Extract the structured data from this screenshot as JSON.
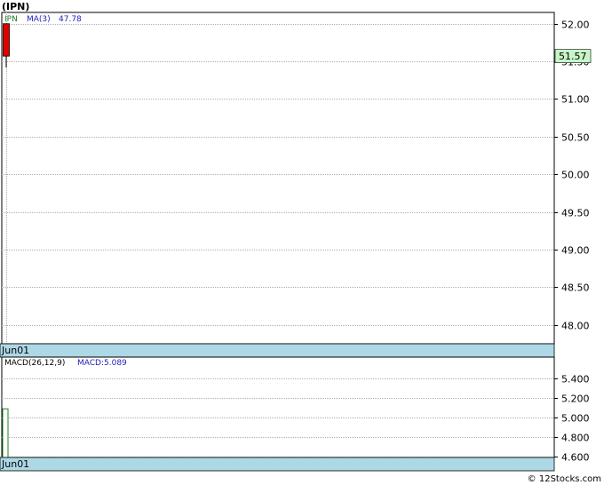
{
  "ticker_title": "(IPN)",
  "copyright": "© 12Stocks.com",
  "colors": {
    "candle_down": "#e00000",
    "price_label_bg": "#c8f5c8",
    "date_bar": "#add8e6",
    "ma_text": "#2020c0",
    "macd_bar": "#208020",
    "grid": "#b0b0b0"
  },
  "chart_data": [
    {
      "type": "candlestick",
      "panel": "price",
      "legend_ticker": "IPN",
      "ma_label": "MA(3)",
      "ma_value": "47.78",
      "y_ticks": [
        "52.00",
        "51.50",
        "51.00",
        "50.50",
        "50.00",
        "49.50",
        "49.00",
        "48.50",
        "48.00"
      ],
      "ylim": [
        47.75,
        52.15
      ],
      "current_price_label": "51.57",
      "x_label": "Jun01",
      "candles": [
        {
          "date": "Jun01",
          "open": 52.0,
          "high": 52.0,
          "low": 51.42,
          "close": 51.57
        }
      ]
    },
    {
      "type": "bar",
      "panel": "macd",
      "legend": "MACD(26,12,9)",
      "macd_label": "MACD:5.089",
      "y_ticks": [
        "5.400",
        "5.200",
        "5.000",
        "4.800",
        "4.600"
      ],
      "ylim": [
        4.59,
        5.62
      ],
      "x_label": "Jun01",
      "values": [
        {
          "date": "Jun01",
          "macd": 5.089
        }
      ]
    }
  ]
}
